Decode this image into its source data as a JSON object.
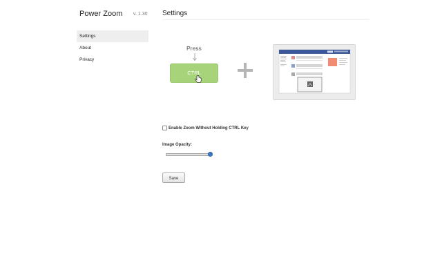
{
  "app": {
    "title": "Power Zoom",
    "version": "v. 1.30"
  },
  "sidebar": {
    "items": [
      {
        "label": "Settings",
        "selected": true
      },
      {
        "label": "About",
        "selected": false
      },
      {
        "label": "Privacy",
        "selected": false
      }
    ]
  },
  "main": {
    "title": "Settings",
    "illustration": {
      "press_label": "Press",
      "key_label": "CTRL",
      "key_color": "#a7d37b",
      "icons": [
        "arrow-down-icon",
        "hand-cursor-icon",
        "plus-icon",
        "webpage-preview-icon"
      ]
    },
    "option": {
      "label": "Enable Zoom Without Holding CTRL Key",
      "checked": false
    },
    "opacity": {
      "label": "Image Opacity:",
      "value_fraction": 1.0
    },
    "save_label": "Save"
  },
  "colors": {
    "accent": "#3b78c4",
    "selected_bg": "#eeeeee",
    "thumbnail_red": "#f28b74"
  }
}
